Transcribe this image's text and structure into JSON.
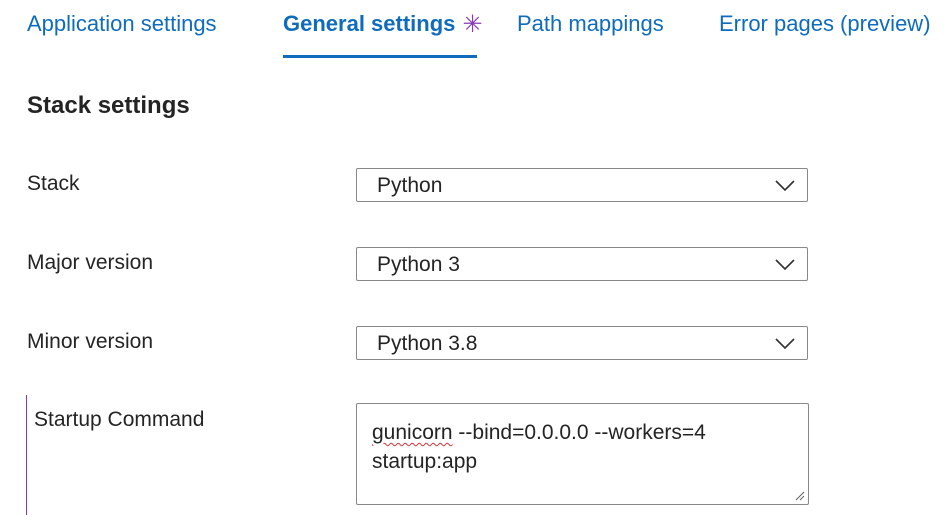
{
  "tabs": [
    {
      "label": "Application settings"
    },
    {
      "label": "General settings",
      "modified_marker": "✳"
    },
    {
      "label": "Path mappings"
    },
    {
      "label": "Error pages (preview)"
    }
  ],
  "active_tab": "General settings",
  "section": {
    "title": "Stack settings"
  },
  "fields": {
    "stack": {
      "label": "Stack",
      "value": "Python"
    },
    "major_version": {
      "label": "Major version",
      "value": "Python 3"
    },
    "minor_version": {
      "label": "Minor version",
      "value": "Python 3.8"
    },
    "startup_command": {
      "label": "Startup Command",
      "value_first_word": "gunicorn",
      "value_rest": " --bind=0.0.0.0 --workers=4\nstartup:app"
    }
  },
  "colors": {
    "accent": "#0f6cbd",
    "modified_marker": "#8a3ab8",
    "border": "#8a8886",
    "spellcheck": "#d13438"
  },
  "icons": {
    "dropdown": "chevron-down-icon",
    "resize": "resize-handle-icon"
  }
}
